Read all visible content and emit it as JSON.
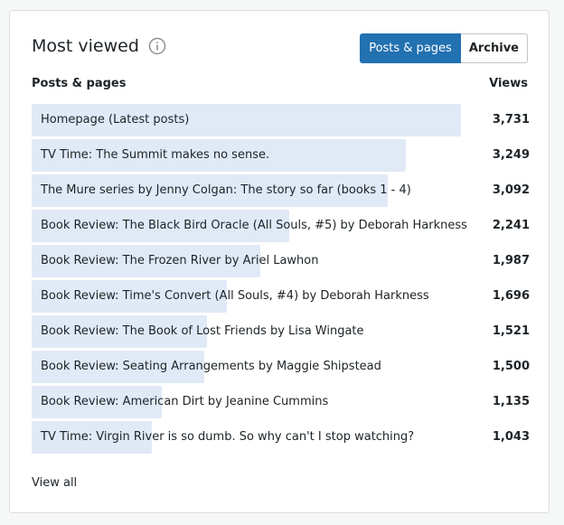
{
  "card": {
    "title": "Most viewed",
    "info_icon": "info-circle-icon",
    "tabs": [
      {
        "label": "Posts & pages",
        "active": true
      },
      {
        "label": "Archive",
        "active": false
      }
    ],
    "columns": {
      "left": "Posts & pages",
      "right": "Views"
    },
    "rows": [
      {
        "label": "Homepage (Latest posts)",
        "views": "3,731",
        "value": 3731
      },
      {
        "label": "TV Time: The Summit makes no sense.",
        "views": "3,249",
        "value": 3249
      },
      {
        "label": "The Mure series by Jenny Colgan: The story so far (books 1 - 4)",
        "views": "3,092",
        "value": 3092
      },
      {
        "label": "Book Review: The Black Bird Oracle (All Souls, #5) by Deborah Harkness",
        "views": "2,241",
        "value": 2241
      },
      {
        "label": "Book Review: The Frozen River by Ariel Lawhon",
        "views": "1,987",
        "value": 1987
      },
      {
        "label": "Book Review: Time's Convert (All Souls, #4) by Deborah Harkness",
        "views": "1,696",
        "value": 1696
      },
      {
        "label": "Book Review: The Book of Lost Friends by Lisa Wingate",
        "views": "1,521",
        "value": 1521
      },
      {
        "label": "Book Review: Seating Arrangements by Maggie Shipstead",
        "views": "1,500",
        "value": 1500
      },
      {
        "label": "Book Review: American Dirt by Jeanine Cummins",
        "views": "1,135",
        "value": 1135
      },
      {
        "label": "TV Time: Virgin River is so dumb. So why can't I stop watching?",
        "views": "1,043",
        "value": 1043
      }
    ],
    "view_all": "View all"
  },
  "colors": {
    "accent": "#2271b1",
    "bar": "#e0e9f6"
  }
}
